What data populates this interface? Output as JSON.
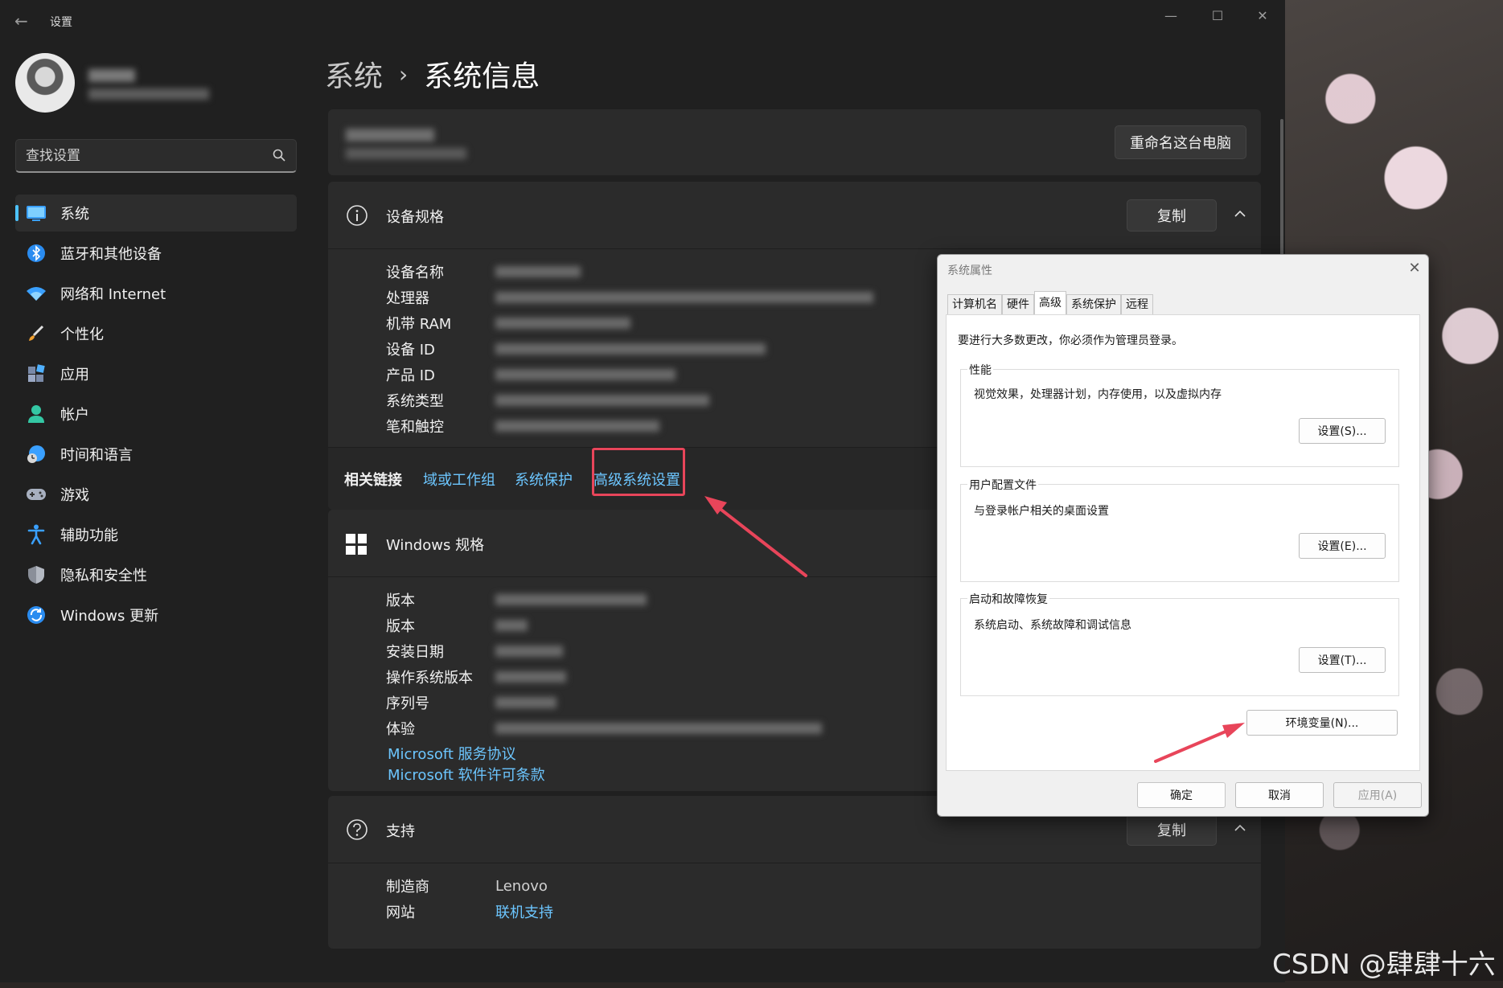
{
  "window": {
    "app_title": "设置",
    "minimize": "—",
    "maximize": "☐",
    "close": "✕"
  },
  "search": {
    "placeholder": "查找设置"
  },
  "sidebar": {
    "items": [
      {
        "label": "系统",
        "active": true
      },
      {
        "label": "蓝牙和其他设备"
      },
      {
        "label": "网络和 Internet"
      },
      {
        "label": "个性化"
      },
      {
        "label": "应用"
      },
      {
        "label": "帐户"
      },
      {
        "label": "时间和语言"
      },
      {
        "label": "游戏"
      },
      {
        "label": "辅助功能"
      },
      {
        "label": "隐私和安全性"
      },
      {
        "label": "Windows 更新"
      }
    ]
  },
  "breadcrumb": {
    "parent": "系统",
    "separator": "›",
    "current": "系统信息"
  },
  "pc_card": {
    "rename_button": "重命名这台电脑"
  },
  "device_spec": {
    "title": "设备规格",
    "copy_button": "复制",
    "rows": [
      {
        "label": "设备名称"
      },
      {
        "label": "处理器"
      },
      {
        "label": "机带 RAM"
      },
      {
        "label": "设备 ID"
      },
      {
        "label": "产品 ID"
      },
      {
        "label": "系统类型"
      },
      {
        "label": "笔和触控"
      }
    ]
  },
  "related_links": {
    "title": "相关链接",
    "domain": "域或工作组",
    "protection": "系统保护",
    "advanced": "高级系统设置"
  },
  "windows_spec": {
    "title": "Windows 规格",
    "rows": [
      {
        "label": "版本"
      },
      {
        "label": "版本"
      },
      {
        "label": "安装日期"
      },
      {
        "label": "操作系统版本"
      },
      {
        "label": "序列号"
      },
      {
        "label": "体验"
      }
    ],
    "ms_service_agreement": "Microsoft 服务协议",
    "ms_license_terms": "Microsoft 软件许可条款"
  },
  "support": {
    "title": "支持",
    "copy_button": "复制",
    "manufacturer_label": "制造商",
    "manufacturer_value": "Lenovo",
    "website_label": "网站",
    "website_value": "联机支持"
  },
  "dialog": {
    "title": "系统属性",
    "close": "✕",
    "tabs": [
      "计算机名",
      "硬件",
      "高级",
      "系统保护",
      "远程"
    ],
    "active_tab": "高级",
    "admin_note": "要进行大多数更改，你必须作为管理员登录。",
    "performance": {
      "label": "性能",
      "desc": "视觉效果，处理器计划，内存使用，以及虚拟内存",
      "button": "设置(S)..."
    },
    "user_profiles": {
      "label": "用户配置文件",
      "desc": "与登录帐户相关的桌面设置",
      "button": "设置(E)..."
    },
    "startup_recovery": {
      "label": "启动和故障恢复",
      "desc": "系统启动、系统故障和调试信息",
      "button": "设置(T)..."
    },
    "env_vars_button": "环境变量(N)...",
    "ok_button": "确定",
    "cancel_button": "取消",
    "apply_button": "应用(A)"
  },
  "watermark": "CSDN @肆肆十六",
  "colors": {
    "accent": "#4cc2ff",
    "link": "#6cc6ff",
    "highlight": "#e8455a",
    "window_bg": "#202020",
    "card_bg": "#2b2b2b"
  }
}
